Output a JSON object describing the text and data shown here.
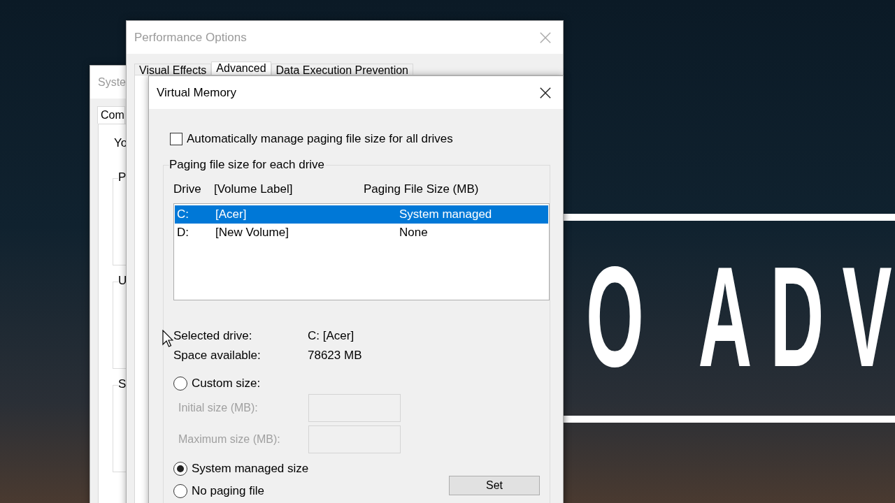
{
  "background": {
    "banner_text": "O ADV"
  },
  "system_properties": {
    "title": "Syste",
    "tabs": [
      {
        "label": "Com",
        "selected": true
      }
    ],
    "intro": "Yo",
    "groups": [
      {
        "label": "P"
      },
      {
        "label": "U"
      },
      {
        "label": "S"
      }
    ]
  },
  "performance_options": {
    "title": "Performance Options",
    "tabs": [
      {
        "label": "Visual Effects",
        "selected": false
      },
      {
        "label": "Advanced",
        "selected": true
      },
      {
        "label": "Data Execution Prevention",
        "selected": false
      }
    ]
  },
  "virtual_memory": {
    "title": "Virtual Memory",
    "auto_manage": {
      "label": "Automatically manage paging file size for all drives",
      "checked": false
    },
    "group_label": "Paging file size for each drive",
    "columns": [
      "Drive",
      "[Volume Label]",
      "Paging File Size (MB)"
    ],
    "drives": [
      {
        "drive": "C:",
        "label": "[Acer]",
        "size": "System managed",
        "selected": true
      },
      {
        "drive": "D:",
        "label": "[New Volume]",
        "size": "None",
        "selected": false
      }
    ],
    "info": [
      {
        "label": "Selected drive:",
        "value": "C:  [Acer]"
      },
      {
        "label": "Space available:",
        "value": "78623 MB"
      }
    ],
    "options": [
      {
        "kind": "custom",
        "label": "Custom size:",
        "selected": false,
        "fields": [
          {
            "label": "Initial size (MB):",
            "disabled": true
          },
          {
            "label": "Maximum size (MB):",
            "disabled": true
          }
        ]
      },
      {
        "kind": "plain",
        "label": "System managed size",
        "selected": true
      },
      {
        "kind": "plain",
        "label": "No paging file",
        "selected": false
      }
    ],
    "set_button": "Set"
  }
}
